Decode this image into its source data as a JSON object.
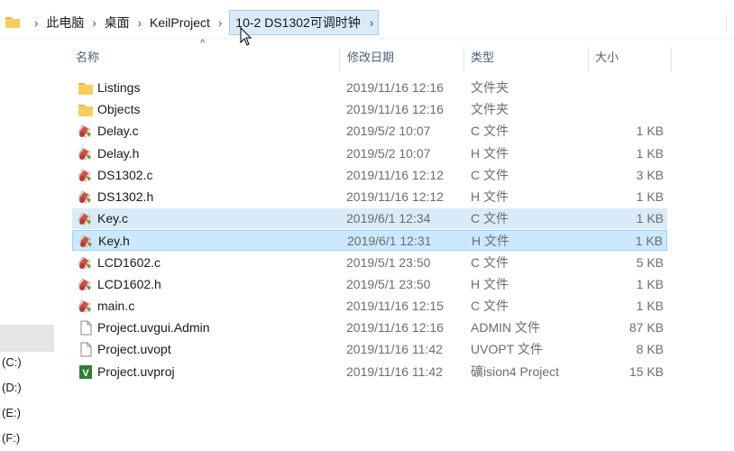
{
  "breadcrumb": {
    "items": [
      "此电脑",
      "桌面",
      "KeilProject"
    ],
    "current": "10-2 DS1302可调时钟"
  },
  "columns": {
    "name": "名称",
    "date": "修改日期",
    "type": "类型",
    "size": "大小"
  },
  "files": [
    {
      "name": "Listings",
      "date": "2019/11/16 12:16",
      "type": "文件夹",
      "size": "",
      "icon": "folder"
    },
    {
      "name": "Objects",
      "date": "2019/11/16 12:16",
      "type": "文件夹",
      "size": "",
      "icon": "folder"
    },
    {
      "name": "Delay.c",
      "date": "2019/5/2 10:07",
      "type": "C 文件",
      "size": "1 KB",
      "icon": "source"
    },
    {
      "name": "Delay.h",
      "date": "2019/5/2 10:07",
      "type": "H 文件",
      "size": "1 KB",
      "icon": "source"
    },
    {
      "name": "DS1302.c",
      "date": "2019/11/16 12:12",
      "type": "C 文件",
      "size": "3 KB",
      "icon": "source"
    },
    {
      "name": "DS1302.h",
      "date": "2019/11/16 12:12",
      "type": "H 文件",
      "size": "1 KB",
      "icon": "source"
    },
    {
      "name": "Key.c",
      "date": "2019/6/1 12:34",
      "type": "C 文件",
      "size": "1 KB",
      "icon": "source"
    },
    {
      "name": "Key.h",
      "date": "2019/6/1 12:31",
      "type": "H 文件",
      "size": "1 KB",
      "icon": "source"
    },
    {
      "name": "LCD1602.c",
      "date": "2019/5/1 23:50",
      "type": "C 文件",
      "size": "5 KB",
      "icon": "source"
    },
    {
      "name": "LCD1602.h",
      "date": "2019/5/1 23:50",
      "type": "H 文件",
      "size": "1 KB",
      "icon": "source"
    },
    {
      "name": "main.c",
      "date": "2019/11/16 12:15",
      "type": "C 文件",
      "size": "1 KB",
      "icon": "source"
    },
    {
      "name": "Project.uvgui.Admin",
      "date": "2019/11/16 12:16",
      "type": "ADMIN 文件",
      "size": "87 KB",
      "icon": "document"
    },
    {
      "name": "Project.uvopt",
      "date": "2019/11/16 11:42",
      "type": "UVOPT 文件",
      "size": "8 KB",
      "icon": "document"
    },
    {
      "name": "Project.uvproj",
      "date": "2019/11/16 11:42",
      "type": "礦ision4 Project",
      "size": "15 KB",
      "icon": "uvision"
    }
  ],
  "drives": [
    "(C:)",
    "(D:)",
    "(E:)",
    "(F:)"
  ],
  "colors": {
    "selection": "#cce8ff",
    "selection_border": "#99d1ff",
    "hover": "#d9ebf9",
    "header_text": "#4c607a"
  }
}
